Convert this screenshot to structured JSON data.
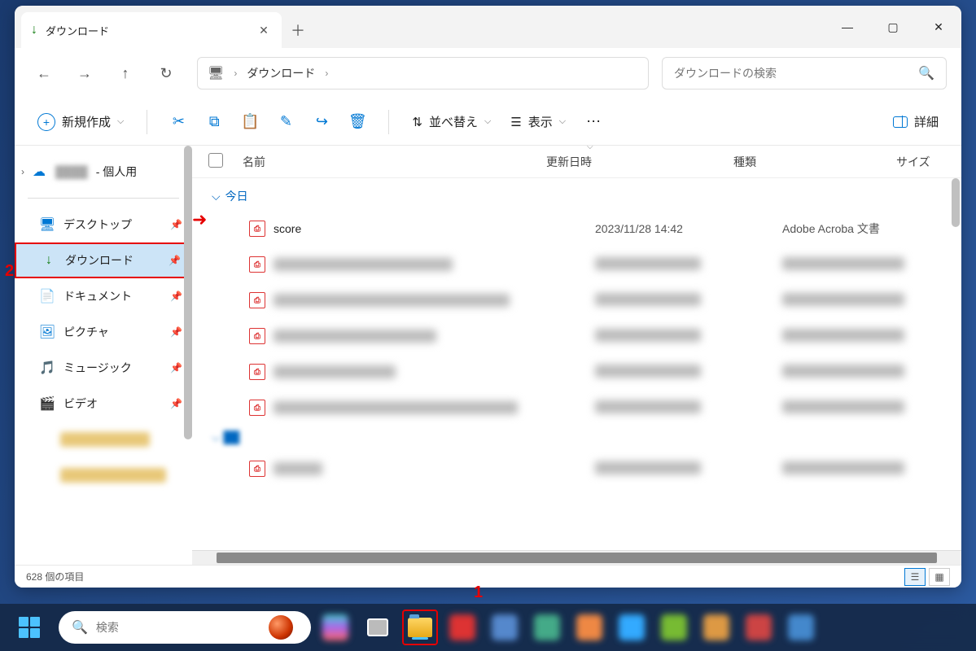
{
  "tab": {
    "title": "ダウンロード"
  },
  "address": {
    "segment": "ダウンロード"
  },
  "search": {
    "placeholder": "ダウンロードの検索"
  },
  "toolbar": {
    "new": "新規作成",
    "sort": "並べ替え",
    "view": "表示",
    "details": "詳細"
  },
  "sidebar": {
    "personal_suffix": " - 個人用",
    "desktop": "デスクトップ",
    "downloads": "ダウンロード",
    "documents": "ドキュメント",
    "pictures": "ピクチャ",
    "music": "ミュージック",
    "videos": "ビデオ"
  },
  "columns": {
    "name": "名前",
    "date": "更新日時",
    "type": "種類",
    "size": "サイズ"
  },
  "group": {
    "today": "今日"
  },
  "file": {
    "name": "score",
    "date": "2023/11/28 14:42",
    "type": "Adobe Acroba 文書"
  },
  "status": {
    "count": "628 個の項目"
  },
  "taskbar": {
    "search_placeholder": "検索"
  },
  "annotations": {
    "num1": "1",
    "num2": "2"
  }
}
